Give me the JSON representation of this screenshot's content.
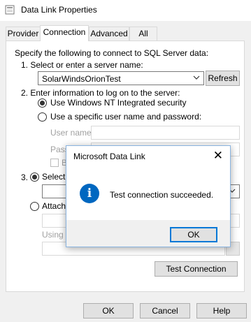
{
  "window": {
    "title": "Data Link Properties"
  },
  "tabs": [
    {
      "label": "Provider",
      "active": false
    },
    {
      "label": "Connection",
      "active": true
    },
    {
      "label": "Advanced",
      "active": false
    },
    {
      "label": "All",
      "active": false
    }
  ],
  "connection": {
    "intro": "Specify the following to connect to SQL Server data:",
    "step1_label": "1. Select or enter a server name:",
    "server_name": "SolarWindsOrionTest",
    "refresh_label": "Refresh",
    "step2_label": "2. Enter information to log on to the server:",
    "option_nt": "Use Windows NT Integrated security",
    "option_specific": "Use a specific user name and password:",
    "username_label": "User name:",
    "password_label_partial": "Pass",
    "blank_checkbox_partial": "B",
    "step3_label_partial": "3.",
    "select_db_partial": "Select t",
    "attach_partial": "Attach",
    "using_partial": "Using t",
    "test_connection_label": "Test Connection"
  },
  "dialog": {
    "title": "Microsoft Data Link",
    "message": "Test connection succeeded.",
    "ok_label": "OK",
    "icon": "info-icon",
    "close_symbol": "✕"
  },
  "footer": {
    "ok_label": "OK",
    "cancel_label": "Cancel",
    "help_label": "Help"
  },
  "colors": {
    "accent": "#0078d7",
    "info_blue": "#0067c0"
  }
}
